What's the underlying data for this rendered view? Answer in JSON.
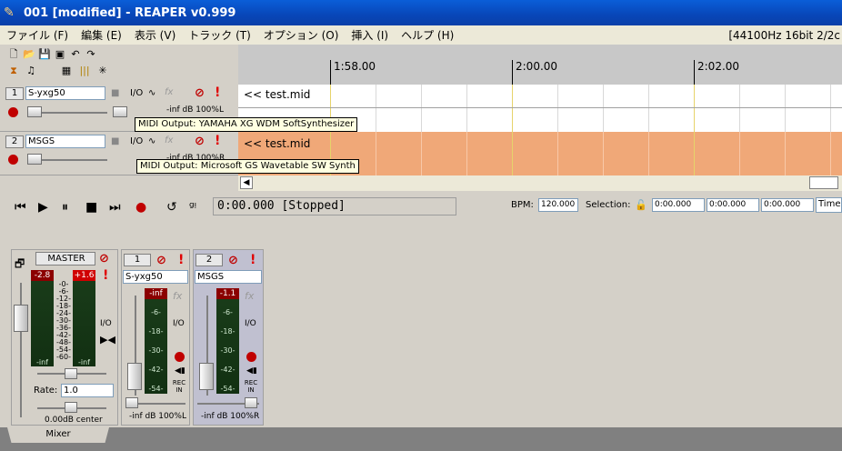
{
  "window": {
    "title": "001 [modified] - REAPER v0.999"
  },
  "menu": {
    "items": [
      "ファイル (F)",
      "編集 (E)",
      "表示 (V)",
      "トラック (T)",
      "オプション (O)",
      "挿入 (I)",
      "ヘルプ (H)"
    ],
    "status": "[44100Hz 16bit 2/2c"
  },
  "ruler": {
    "labels": [
      "1:58.00",
      "2:00.00",
      "2:02.00"
    ]
  },
  "tracks": [
    {
      "num": "1",
      "name": "S-yxg50",
      "io": "I/O",
      "fx": "fx",
      "vol": "-inf dB 100%L",
      "item": "<< test.mid",
      "tooltip": "MIDI Output: YAMAHA XG WDM SoftSynthesizer"
    },
    {
      "num": "2",
      "name": "MSGS",
      "io": "I/O",
      "fx": "fx",
      "vol": "-inf dB 100%R",
      "item": "<< test.mid",
      "tooltip": "MIDI Output: Microsoft GS Wavetable SW Synth"
    }
  ],
  "transport": {
    "time": "0:00.000 [Stopped]",
    "bpm_label": "BPM:",
    "bpm": "120.000",
    "selection_label": "Selection:",
    "sel_start": "0:00.000",
    "sel_end": "0:00.000",
    "sel_len": "0:00.000",
    "time_mode": "Time"
  },
  "mixer": {
    "master": {
      "label": "MASTER",
      "peak_l": "-2.8",
      "peak_r": "+1.6",
      "bottom_l": "-inf",
      "bottom_r": "-inf",
      "rate_label": "Rate:",
      "rate": "1.0",
      "vol": "0.00dB center",
      "io": "I/O"
    },
    "strips": [
      {
        "num": "1",
        "name": "S-yxg50",
        "peak": "-inf",
        "vol": "-inf dB 100%L",
        "io": "I/O",
        "fx": "fx",
        "rec": "REC IN"
      },
      {
        "num": "2",
        "name": "MSGS",
        "peak": "-1.1",
        "vol": "-inf dB 100%R",
        "io": "I/O",
        "fx": "fx",
        "rec": "REC IN"
      }
    ],
    "meter_scale": [
      "-0-",
      "-6-",
      "-12-",
      "-18-",
      "-24-",
      "-30-",
      "-36-",
      "-42-",
      "-48-",
      "-54-",
      "-60-"
    ],
    "strip_scale": [
      "-6-",
      "-18-",
      "-30-",
      "-42-",
      "-54-"
    ],
    "tab": "Mixer"
  },
  "colors": {
    "title_bar": "#0846b8",
    "track2_lane": "#f0a878",
    "grid_yellow": "#e6d36a"
  }
}
